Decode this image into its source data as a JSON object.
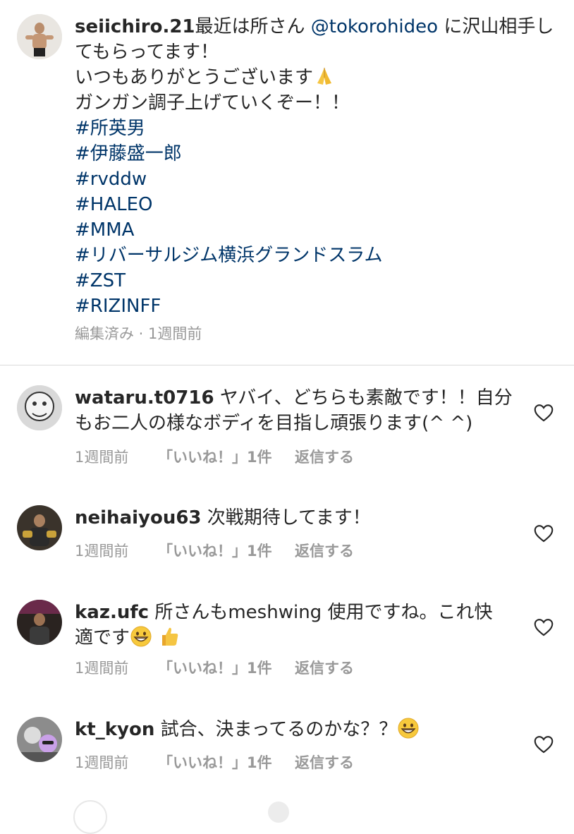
{
  "caption": {
    "username": "seiichiro.21",
    "text_before_mention": "最近は所さん ",
    "mention": "@tokorohideo",
    "text_after_mention": " に沢山相手してもらってます！",
    "line2": "いつもありがとうございます",
    "line2_emoji": "folded-hands",
    "line3": "ガンガン調子上げていくぞー！！",
    "hashtags": [
      "#所英男",
      "#伊藤盛一郎",
      "#rvddw",
      "#HALEO",
      "#MMA",
      "#リバーサルジム横浜グランドスラム",
      "#ZST",
      "#RIZINFF"
    ],
    "meta": "編集済み · 1週間前"
  },
  "comments": [
    {
      "username": "wataru.t0716",
      "text": " ヤバイ、どちらも素敵です！！自分もお二人の様なボディを目指し頑張ります(^ ^)",
      "time": "1週間前",
      "likes": "「いいね！」1件",
      "reply": "返信する"
    },
    {
      "username": "neihaiyou63",
      "text": " 次戦期待してます！",
      "time": "1週間前",
      "likes": "「いいね！」1件",
      "reply": "返信する"
    },
    {
      "username": "kaz.ufc",
      "text": " 所さんもmeshwing 使用ですね。これ快適です",
      "emojis": [
        "grinning-face",
        "thumbs-up"
      ],
      "time": "1週間前",
      "likes": "「いいね！」1件",
      "reply": "返信する"
    },
    {
      "username": "kt_kyon",
      "text": " 試合、決まってるのかな？？",
      "emojis": [
        "grinning-face"
      ],
      "time": "1週間前",
      "likes": "「いいね！」1件",
      "reply": "返信する"
    }
  ],
  "icons": {
    "like": "heart-outline-icon"
  },
  "colors": {
    "link": "#003569",
    "meta": "#999999",
    "text": "#262626",
    "divider": "#dbdbdb"
  }
}
